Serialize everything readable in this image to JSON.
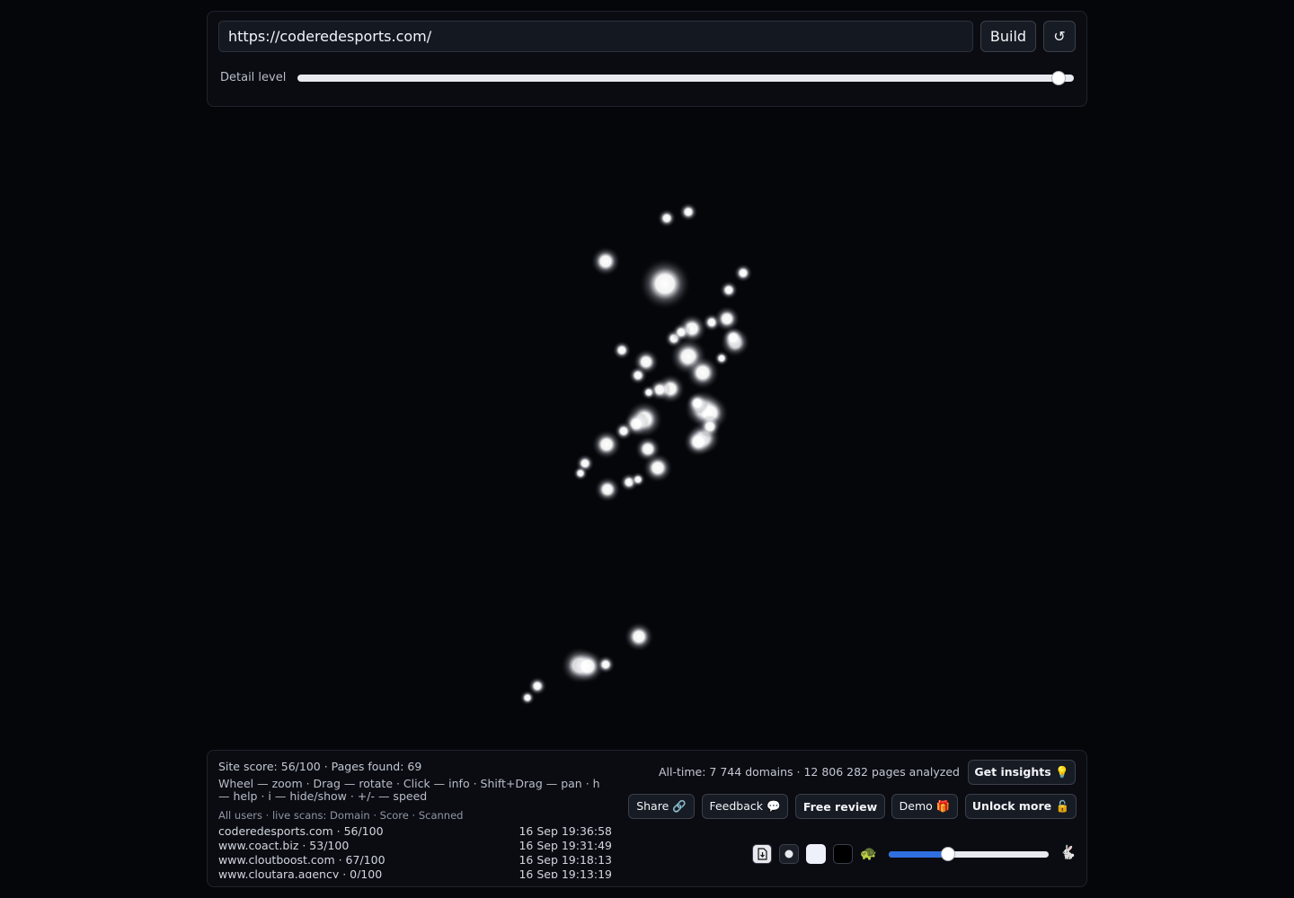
{
  "toolbar": {
    "url_value": "https://coderedesports.com/",
    "build_label": "Build",
    "reset_icon": "↺",
    "detail_label": "Detail level",
    "detail_level": 0.98
  },
  "graph": {
    "description_icon": "node-cluster"
  },
  "stats": {
    "site_stats": "Site score: 56/100 · Pages found: 69",
    "help": "Wheel — zoom · Drag — rotate · Click — info · Shift+Drag — pan · h — help · i — hide/show · +/- — speed",
    "scans_header": "All users · live scans: Domain · Score · Scanned",
    "scans": [
      {
        "domain": "coderedesports.com · 56/100",
        "time": "16 Sep 19:36:58"
      },
      {
        "domain": "www.coact.biz · 53/100",
        "time": "16 Sep 19:31:49"
      },
      {
        "domain": "www.cloutboost.com · 67/100",
        "time": "16 Sep 19:18:13"
      },
      {
        "domain": "www.cloutara.agency · 0/100",
        "time": "16 Sep 19:13:19"
      }
    ],
    "alltime": "All-time: 7 744 domains · 12 806 282 pages analyzed"
  },
  "actions": {
    "insights": "Get insights 💡",
    "share": "Share 🔗",
    "feedback": "Feedback 💬",
    "review": "Free review",
    "demo": "Demo 🎁",
    "unlock": "Unlock more 🔓"
  },
  "controls": {
    "turtle": "🐢",
    "rabbit": "🐇",
    "speed_level": 0.37
  }
}
